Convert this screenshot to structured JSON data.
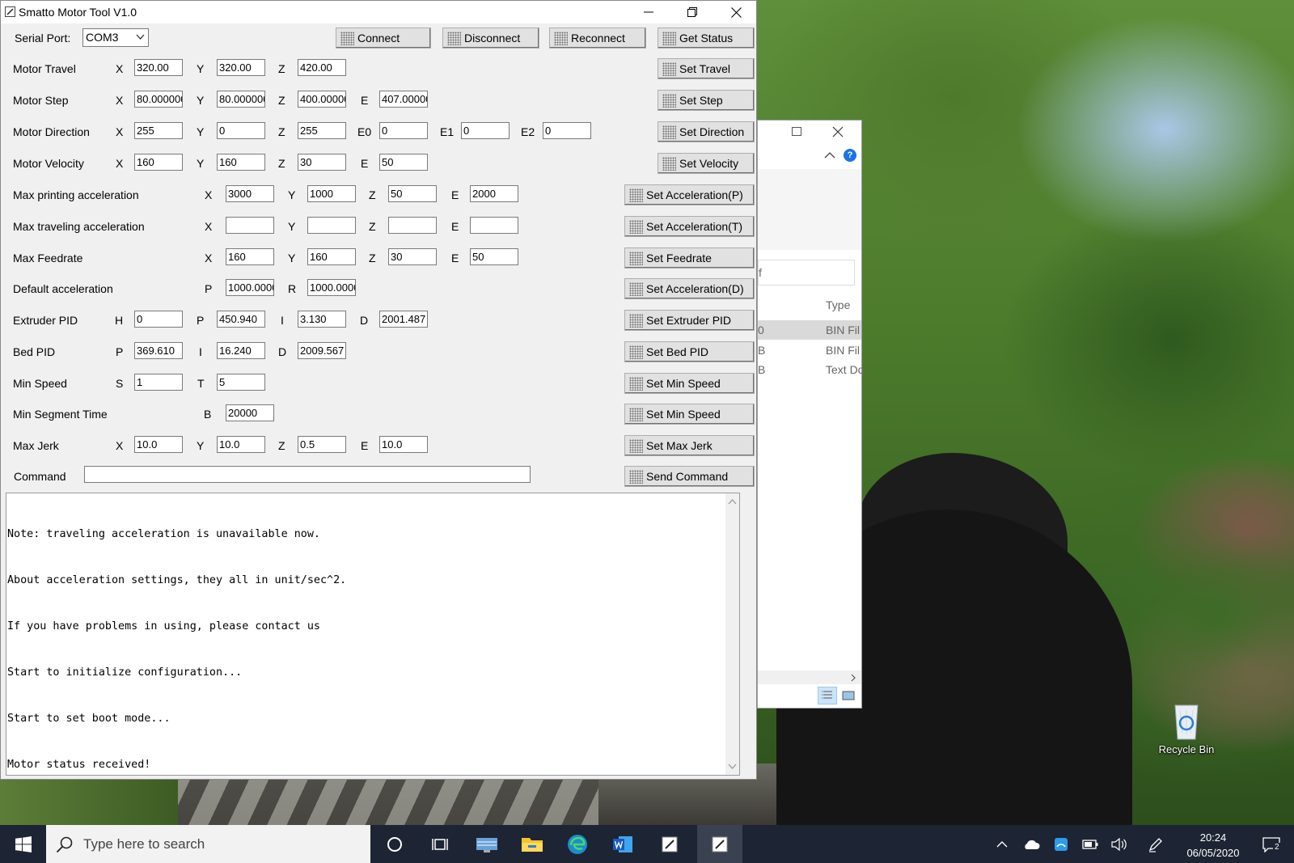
{
  "window": {
    "title": "Smatto Motor Tool V1.0"
  },
  "serial": {
    "label": "Serial Port:",
    "port": "COM3"
  },
  "connection_buttons": {
    "connect": "Connect",
    "disconnect": "Disconnect",
    "reconnect": "Reconnect",
    "get_status": "Get Status"
  },
  "rows": {
    "travel": {
      "label": "Motor Travel",
      "x": "320.00",
      "y": "320.00",
      "z": "420.00",
      "button": "Set Travel"
    },
    "step": {
      "label": "Motor Step",
      "x": "80.000000",
      "y": "80.000000",
      "z": "400.00000",
      "e": "407.00000",
      "button": "Set Step"
    },
    "direction": {
      "label": "Motor Direction",
      "x": "255",
      "y": "0",
      "z": "255",
      "e0": "0",
      "e1": "0",
      "e2": "0",
      "button": "Set Direction"
    },
    "velocity": {
      "label": "Motor Velocity",
      "x": "160",
      "y": "160",
      "z": "30",
      "e": "50",
      "button": "Set Velocity"
    },
    "print_accel": {
      "label": "Max printing acceleration",
      "x": "3000",
      "y": "1000",
      "z": "50",
      "e": "2000",
      "button": "Set Acceleration(P)"
    },
    "travel_accel": {
      "label": "Max traveling acceleration",
      "x": "",
      "y": "",
      "z": "",
      "e": "",
      "button": "Set Acceleration(T)"
    },
    "feedrate": {
      "label": "Max Feedrate",
      "x": "160",
      "y": "160",
      "z": "30",
      "e": "50",
      "button": "Set Feedrate"
    },
    "default_accel": {
      "label": "Default acceleration",
      "p": "1000.0000",
      "r": "1000.0000",
      "button": "Set Acceleration(D)"
    },
    "extruder_pid": {
      "label": "Extruder PID",
      "h": "0",
      "p": "450.940",
      "i": "3.130",
      "d": "2001.487",
      "button": "Set Extruder PID"
    },
    "bed_pid": {
      "label": "Bed PID",
      "p": "369.610",
      "i": "16.240",
      "d": "2009.567",
      "button": "Set Bed PID"
    },
    "min_speed": {
      "label": "Min Speed",
      "s": "1",
      "t": "5",
      "button": "Set Min Speed"
    },
    "min_segment": {
      "label": "Min Segment Time",
      "b": "20000",
      "button": "Set Min Speed"
    },
    "max_jerk": {
      "label": "Max Jerk",
      "x": "10.0",
      "y": "10.0",
      "z": "0.5",
      "e": "10.0",
      "button": "Set Max Jerk"
    },
    "command": {
      "label": "Command",
      "value": "",
      "button": "Send Command"
    }
  },
  "axis_labels": {
    "x": "X",
    "y": "Y",
    "z": "Z",
    "e": "E",
    "e0": "E0",
    "e1": "E1",
    "e2": "E2",
    "p": "P",
    "r": "R",
    "h": "H",
    "i": "I",
    "d": "D",
    "s": "S",
    "t": "T",
    "b": "B"
  },
  "log": [
    "Note: traveling acceleration is unavailable now.",
    "About acceleration settings, they all in unit/sec^2.",
    "If you have problems in using, please contact us",
    "Start to initialize configuration...",
    "Start to set boot mode...",
    "Motor status received!"
  ],
  "explorer": {
    "type_header": "Type",
    "row1_a": "0",
    "row1_b": "BIN Fil",
    "row2_a": "B",
    "row2_b": "BIN Fil",
    "row3_a": "B",
    "row3_b": "Text Do",
    "filter_char": "f"
  },
  "desktop": {
    "recycle_bin": "Recycle Bin"
  },
  "taskbar": {
    "search_placeholder": "Type here to search",
    "time": "20:24",
    "date": "06/05/2020",
    "notification_count": "2"
  },
  "icons": {
    "minimize": "minimize-icon",
    "maximize": "restore-icon",
    "close": "close-icon",
    "start": "windows-logo-icon",
    "search": "magnifier-icon",
    "cortana": "circle-icon",
    "taskview": "task-view-icon"
  }
}
